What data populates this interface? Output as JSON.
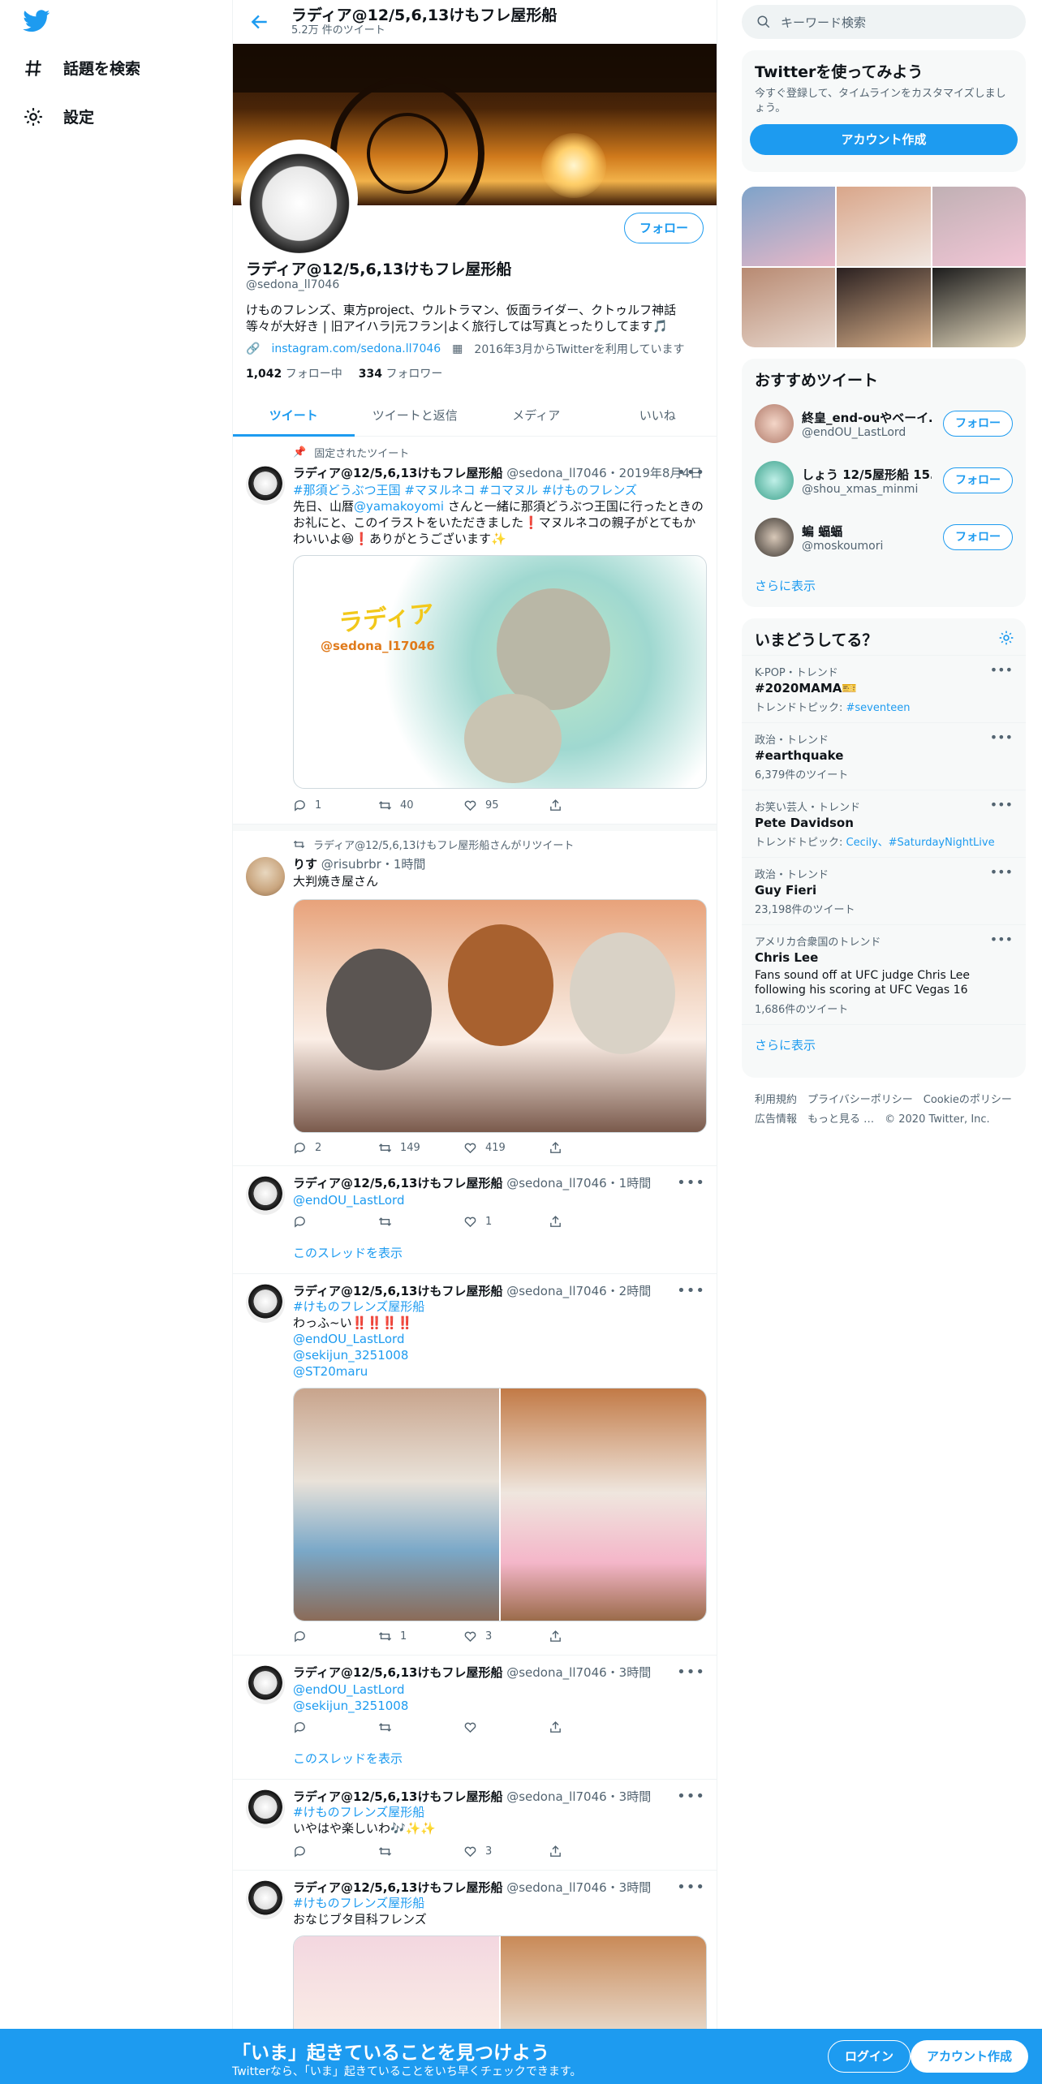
{
  "nav": {
    "explore": "話題を検索",
    "settings": "設定"
  },
  "header": {
    "title": "ラディア@12/5,6,13けもフレ屋形船",
    "subtitle": "5.2万 件のツイート"
  },
  "profile": {
    "follow": "フォロー",
    "name": "ラディア@12/5,6,13けもフレ屋形船",
    "handle": "@sedona_ll7046",
    "bio": "けものフレンズ、東方project、ウルトラマン、仮面ライダー、クトゥルフ神話等々が大好き | 旧アイハラ|元フラン|よく旅行しては写真とったりしてます🎵",
    "link": "instagram.com/sedona.ll7046",
    "joined": "2016年3月からTwitterを利用しています",
    "following_count": "1,042",
    "following_label": "フォロー中",
    "followers_count": "334",
    "followers_label": "フォロワー"
  },
  "tabs": [
    "ツイート",
    "ツイートと返信",
    "メディア",
    "いいね"
  ],
  "tweets": {
    "t1": {
      "context": "固定されたツイート",
      "name": "ラディア@12/5,6,13けもフレ屋形船",
      "meta": "@sedona_ll7046・2019年8月4日",
      "tags": "#那須どうぶつ王国 #マヌルネコ #コマヌル #けものフレンズ",
      "text1": "先日、山暦",
      "mention": "@yamakoyomi",
      "text2": " さんと一緒に那須どうぶつ王国に行ったときのお礼にと、このイラストをいただきました❗マヌルネコの親子がとてもかわいいよ😆❗ありがとうございます✨",
      "media_caption": "ラディア",
      "media_handle": "@sedona_l17046",
      "replies": "1",
      "retweets": "40",
      "likes": "95"
    },
    "t2": {
      "context": "ラディア@12/5,6,13けもフレ屋形船さんがリツイート",
      "name": "りす",
      "meta": "@risubrbr・1時間",
      "text": "大判焼き屋さん",
      "replies": "2",
      "retweets": "149",
      "likes": "419"
    },
    "t3": {
      "name": "ラディア@12/5,6,13けもフレ屋形船",
      "meta": "@sedona_ll7046・1時間",
      "reply_to": "@endOU_LastLord",
      "likes": "1",
      "thread": "このスレッドを表示"
    },
    "t4": {
      "name": "ラディア@12/5,6,13けもフレ屋形船",
      "meta": "@sedona_ll7046・2時間",
      "tag": "#けものフレンズ屋形船",
      "text": "わっふ~い‼️‼️‼️‼️",
      "m1": "@endOU_LastLord",
      "m2": "@sekijun_3251008",
      "m3": "@ST20maru",
      "retweets": "1",
      "likes": "3"
    },
    "t5": {
      "name": "ラディア@12/5,6,13けもフレ屋形船",
      "meta": "@sedona_ll7046・3時間",
      "m1": "@endOU_LastLord",
      "m2": "@sekijun_3251008",
      "thread": "このスレッドを表示"
    },
    "t6": {
      "name": "ラディア@12/5,6,13けもフレ屋形船",
      "meta": "@sedona_ll7046・3時間",
      "tag": "#けものフレンズ屋形船",
      "text": "いやはや楽しいわ🎶✨✨",
      "likes": "3"
    },
    "t7": {
      "name": "ラディア@12/5,6,13けもフレ屋形船",
      "meta": "@sedona_ll7046・3時間",
      "tag": "#けものフレンズ屋形船",
      "text": "おなじブタ目科フレンズ"
    }
  },
  "sidebar": {
    "search_placeholder": "キーワード検索",
    "signup": {
      "title": "Twitterを使ってみよう",
      "text": "今すぐ登録して、タイムラインをカスタマイズしましょう。",
      "button": "アカウント作成"
    },
    "wtf": {
      "title": "おすすめツイート",
      "users": [
        {
          "name": "終皇_end-ouやベーイ…",
          "handle": "@endOU_LastLord",
          "button": "フォロー"
        },
        {
          "name": "しょう 12/5屋形船 15…",
          "handle": "@shou_xmas_minmi",
          "button": "フォロー"
        },
        {
          "name": "蝙 蝠蝠",
          "handle": "@moskoumori",
          "button": "フォロー"
        }
      ],
      "more": "さらに表示"
    },
    "trends": {
      "title": "いまどうしてる？",
      "items": [
        {
          "context": "K-POP・トレンド",
          "name": "#2020MAMA🎫",
          "extra_label": "トレンドトピック: ",
          "extra_link": "#seventeen"
        },
        {
          "context": "政治・トレンド",
          "name": "#earthquake",
          "extra": "6,379件のツイート"
        },
        {
          "context": "お笑い芸人・トレンド",
          "name": "Pete Davidson",
          "extra_label": "トレンドトピック: ",
          "extra_link": "Cecily、#SaturdayNightLive"
        },
        {
          "context": "政治・トレンド",
          "name": "Guy Fieri",
          "extra": "23,198件のツイート"
        },
        {
          "context": "アメリカ合衆国のトレンド",
          "name": "Chris Lee",
          "desc": "Fans sound off at UFC judge Chris Lee following his scoring at UFC Vegas 16",
          "extra": "1,686件のツイート"
        }
      ],
      "more": "さらに表示"
    },
    "footer": {
      "line1": "利用規約　プライバシーポリシー　Cookieのポリシー",
      "line2": "広告情報　もっと見る …　© 2020 Twitter, Inc."
    }
  },
  "bottombar": {
    "title": "「いま」起きていることを見つけよう",
    "subtitle": "Twitterなら、「いま」起きていることをいち早くチェックできます。",
    "login": "ログイン",
    "signup": "アカウント作成"
  },
  "colors": {
    "accent": "#1d9bf0",
    "bg": "#ffffff",
    "muted": "#536471"
  }
}
